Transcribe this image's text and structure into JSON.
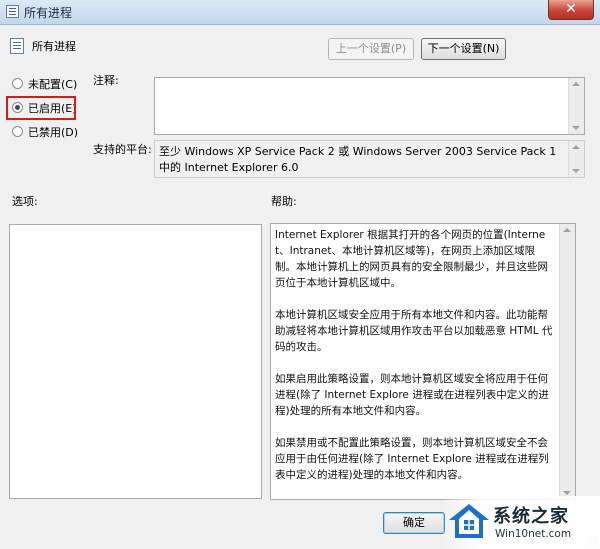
{
  "window": {
    "title": "所有进程",
    "close_glyph": "✕"
  },
  "policy": {
    "name": "所有进程"
  },
  "nav": {
    "prev_label": "上一个设置(P)",
    "next_label": "下一个设置(N)"
  },
  "options": {
    "not_configured": "未配置(C)",
    "enabled": "已启用(E)",
    "disabled": "已禁用(D)",
    "selected": "enabled"
  },
  "labels": {
    "comment": "注释:",
    "supported_on": "支持的平台:",
    "options": "选项:",
    "help": "帮助:"
  },
  "comment_value": "",
  "platform_text": "至少 Windows XP Service Pack 2 或 Windows Server 2003 Service Pack 1中的 Internet Explorer 6.0",
  "help": {
    "paragraphs": [
      "Internet Explorer 根据其打开的各个网页的位置(Internet、Intranet、本地计算机区域等)，在网页上添加区域限制。本地计算机上的网页具有的安全限制最少，并且这些网页位于本地计算机区域中。",
      "本地计算机区域安全应用于所有本地文件和内容。此功能帮助减轻将本地计算机区域用作攻击平台以加载恶意 HTML 代码的攻击。",
      "如果启用此策略设置，则本地计算机区域安全将应用于任何进程(除了 Internet Explore 进程或在进程列表中定义的进程)处理的所有本地文件和内容。",
      "如果禁用或不配置此策略设置，则本地计算机区域安全不会应用于由任何进程(除了 Internet Explore 进程或在进程列表中定义的进程)处理的本地文件和内容。"
    ]
  },
  "footer": {
    "ok_label": "确定"
  },
  "watermark": {
    "brand": "系统之家",
    "url": "Win10net.com"
  }
}
